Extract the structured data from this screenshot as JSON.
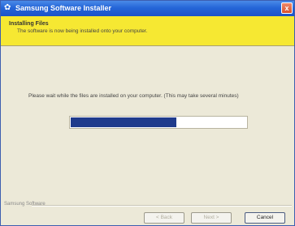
{
  "window": {
    "title": "Samsung Software Installer",
    "close_label": "x"
  },
  "header": {
    "title": "Installing Files",
    "subtitle": "The software is now being installed onto your computer."
  },
  "main": {
    "message": "Please wait while the files are installed on your computer. (This may take several minutes)",
    "progress": 0.6
  },
  "footer": {
    "brand": "Samsung Software"
  },
  "buttons": {
    "back": "< Back",
    "next": "Next >",
    "cancel": "Cancel"
  },
  "colors": {
    "titlebar": "#2566d8",
    "header_band": "#f6e832",
    "progress_fill": "#1f3b8c"
  }
}
